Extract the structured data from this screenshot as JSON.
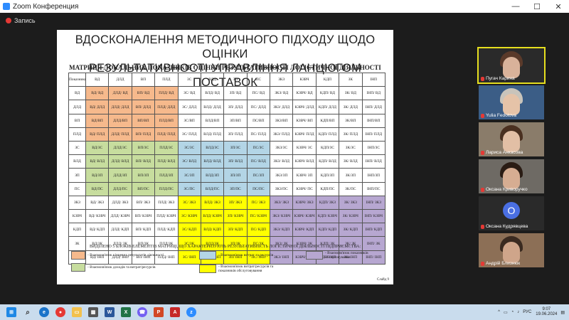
{
  "window": {
    "title": "Zoom Конференция",
    "minimize": "—",
    "maximize": "☐",
    "close": "✕"
  },
  "recording": {
    "label": "Запись"
  },
  "slide": {
    "title_line1": "ВДОСКОНАЛЕННЯ МЕТОДИЧНОГО ПІДХОДУ ЩОДО ОЦІНКИ",
    "title_line2": "РЕЗУЛЬТАТИВНОСТІ УПРАВЛІННЯ ЛАНЦЮГОМ ПОСТАВОК",
    "matrix_title": "МАТРИЦЯ ЛОКАЛЬНИХ ПОКАЗНИКІВ ОЦІНКИ РЕЗУЛЬТАТИВНОСТІ ЛОГІСТИЧНОЇ ДІЯЛЬНОСТІ",
    "header": [
      "Показники",
      "ВД",
      "ДЛД",
      "ВП",
      "ПЛД",
      "ЗС",
      "ВЛД",
      "ЗП",
      "ПС",
      "ЗКЗ",
      "КЗВЧ",
      "КДП",
      "ЗК",
      "ІНП"
    ],
    "rows": [
      [
        [
          "ВД",
          ""
        ],
        [
          "ВД/ ВД",
          "o"
        ],
        [
          "ДЛД/ ВД",
          "o"
        ],
        [
          "ВП/ ВД",
          "o"
        ],
        [
          "ПЛД/ ВД",
          "o"
        ],
        [
          "ЗС/ ВД",
          ""
        ],
        [
          "ВЛД/ ВД",
          ""
        ],
        [
          "ЗП/ ВД",
          ""
        ],
        [
          "ПС/ ВД",
          ""
        ],
        [
          "ЗКЗ/ ВД",
          ""
        ],
        [
          "КЗВЧ/ ВД",
          ""
        ],
        [
          "КДП/ ВД",
          ""
        ],
        [
          "ЗК/ ВД",
          ""
        ],
        [
          "ІНП/ ВД",
          ""
        ]
      ],
      [
        [
          "ДЛД",
          ""
        ],
        [
          "ВД/ ДЛД",
          "o"
        ],
        [
          "ДЛД/ ДЛД",
          "o"
        ],
        [
          "ВП/ ДЛД",
          "o"
        ],
        [
          "ПЛД/ ДЛД",
          "o"
        ],
        [
          "ЗС/ ДЛД",
          ""
        ],
        [
          "ВЛД/ ДЛД",
          ""
        ],
        [
          "ЗП/ ДЛД",
          ""
        ],
        [
          "ПС/ ДЛД",
          ""
        ],
        [
          "ЗКЗ/ ДЛД",
          ""
        ],
        [
          "КЗВЧ/ ДЛД",
          ""
        ],
        [
          "КДП/ ДЛД",
          ""
        ],
        [
          "ЗК/ ДЛД",
          ""
        ],
        [
          "ІНП/ ДЛД",
          ""
        ]
      ],
      [
        [
          "ВП",
          ""
        ],
        [
          "ВД/ВП",
          "o"
        ],
        [
          "ДЛД/ВП",
          "o"
        ],
        [
          "ВП/ВП",
          "o"
        ],
        [
          "ПЛД/ВП",
          "o"
        ],
        [
          "ЗС/ВП",
          ""
        ],
        [
          "ВЛД/ВП",
          ""
        ],
        [
          "ЗП/ВП",
          ""
        ],
        [
          "ПС/ВП",
          ""
        ],
        [
          "ЗКЗ/ВП",
          ""
        ],
        [
          "КЗВЧ/ ВП",
          ""
        ],
        [
          "КДП/ВП",
          ""
        ],
        [
          "ЗК/ВП",
          ""
        ],
        [
          "ІНП/ВП",
          ""
        ]
      ],
      [
        [
          "ПЛД",
          ""
        ],
        [
          "ВД/ ПЛД",
          "o"
        ],
        [
          "ДЛД/ ПЛД",
          "o"
        ],
        [
          "ВП/ ПЛД",
          "o"
        ],
        [
          "ПЛД/ ПЛД",
          "o"
        ],
        [
          "ЗС/ ПЛД",
          ""
        ],
        [
          "ВЛД/ ПЛД",
          ""
        ],
        [
          "ЗП/ ПЛД",
          ""
        ],
        [
          "ПС/ ПЛД",
          ""
        ],
        [
          "ЗКЗ/ ПЛД",
          ""
        ],
        [
          "КЗВЧ/ ПЛД",
          ""
        ],
        [
          "КДП/ ПЛД",
          ""
        ],
        [
          "ЗК/ ПЛД",
          ""
        ],
        [
          "ІНП/ ПЛД",
          ""
        ]
      ],
      [
        [
          "ЗС",
          ""
        ],
        [
          "ВД/ЗС",
          "g"
        ],
        [
          "ДЛД/ЗС",
          "g"
        ],
        [
          "ВП/ЗС",
          "g"
        ],
        [
          "ПЛД/ЗС",
          "g"
        ],
        [
          "ЗС/ЗС",
          "b"
        ],
        [
          "ВЛД/ЗС",
          "b"
        ],
        [
          "ЗП/ЗС",
          "b"
        ],
        [
          "ПС/ЗС",
          "b"
        ],
        [
          "ЗКЗ/ЗС",
          ""
        ],
        [
          "КЗВЧ/ ЗС",
          ""
        ],
        [
          "КДП/ЗС",
          ""
        ],
        [
          "ЗК/ЗС",
          ""
        ],
        [
          "ІНП/ЗС",
          ""
        ]
      ],
      [
        [
          "ВЛД",
          ""
        ],
        [
          "ВД/ ВЛД",
          "g"
        ],
        [
          "ДЛД/ ВЛД",
          "g"
        ],
        [
          "ВП/ ВЛД",
          "g"
        ],
        [
          "ПЛД/ ВЛД",
          "g"
        ],
        [
          "ЗС/ ВЛД",
          "b"
        ],
        [
          "ВЛД/ ВЛД",
          "b"
        ],
        [
          "ЗП/ ВЛД",
          "b"
        ],
        [
          "ПС/ ВЛД",
          "b"
        ],
        [
          "ЗКЗ/ ВЛД",
          ""
        ],
        [
          "КЗВЧ/ ВЛД",
          ""
        ],
        [
          "КДП/ ВЛД",
          ""
        ],
        [
          "ЗК/ ВЛД",
          ""
        ],
        [
          "ІНП/ ВЛД",
          ""
        ]
      ],
      [
        [
          "ЗП",
          ""
        ],
        [
          "ВД/ЗП",
          "g"
        ],
        [
          "ДЛД/ЗП",
          "g"
        ],
        [
          "ВП/ЗП",
          "g"
        ],
        [
          "ПЛД/ЗП",
          "g"
        ],
        [
          "ЗС/ЗП",
          "b"
        ],
        [
          "ВЛД/ЗП",
          "b"
        ],
        [
          "ЗП/ЗП",
          "b"
        ],
        [
          "ПС/ЗП",
          "b"
        ],
        [
          "ЗКЗ/ЗП",
          ""
        ],
        [
          "КЗВЧ/ ЗП",
          ""
        ],
        [
          "КДП/ЗП",
          ""
        ],
        [
          "ЗК/ЗП",
          ""
        ],
        [
          "ІНП/ЗП",
          ""
        ]
      ],
      [
        [
          "ПС",
          ""
        ],
        [
          "ВД/ПС",
          "g"
        ],
        [
          "ДЛД/ПС",
          "g"
        ],
        [
          "ВП/ПС",
          "g"
        ],
        [
          "ПЛД/ПС",
          "g"
        ],
        [
          "ЗС/ПС",
          "b"
        ],
        [
          "ВЛД/ПС",
          "b"
        ],
        [
          "ЗП/ПС",
          "b"
        ],
        [
          "ПС/ПС",
          "b"
        ],
        [
          "ЗКЗ/ПС",
          ""
        ],
        [
          "КЗВЧ/ ПС",
          ""
        ],
        [
          "КДП/ПС",
          ""
        ],
        [
          "ЗК/ПС",
          ""
        ],
        [
          "ІНП/ПС",
          ""
        ]
      ],
      [
        [
          "ЗКЗ",
          ""
        ],
        [
          "ВД/ ЗКЗ",
          ""
        ],
        [
          "ДЛД/ ЗКЗ",
          ""
        ],
        [
          "ВП/ ЗКЗ",
          ""
        ],
        [
          "ПЛД/ ЗКЗ",
          ""
        ],
        [
          "ЗС/ ЗКЗ",
          "y"
        ],
        [
          "ВЛД/ ЗКЗ",
          "y"
        ],
        [
          "ЗП/ ЗКЗ",
          "y"
        ],
        [
          "ПС/ ЗКЗ",
          "y"
        ],
        [
          "ЗКЗ/ ЗКЗ",
          "p"
        ],
        [
          "КЗВЧ/ ЗКЗ",
          "p"
        ],
        [
          "КДП/ ЗКЗ",
          "p"
        ],
        [
          "ЗК/ ЗКЗ",
          "p"
        ],
        [
          "ІНП/ ЗКЗ",
          "p"
        ]
      ],
      [
        [
          "КЗВЧ",
          ""
        ],
        [
          "ВД/ КЗВЧ",
          ""
        ],
        [
          "ДЛД/ КЗВЧ",
          ""
        ],
        [
          "ВП/ КЗВЧ",
          ""
        ],
        [
          "ПЛД/ КЗВЧ",
          ""
        ],
        [
          "ЗС/ КЗВЧ",
          "y"
        ],
        [
          "ВЛД/ КЗВЧ",
          "y"
        ],
        [
          "ЗП/ КЗВЧ",
          "y"
        ],
        [
          "ПС/ КЗВЧ",
          "y"
        ],
        [
          "ЗКЗ/ КЗВЧ",
          "p"
        ],
        [
          "КЗВЧ/ КЗВЧ",
          "p"
        ],
        [
          "КДП/ КЗВЧ",
          "p"
        ],
        [
          "ЗК/ КЗВЧ",
          "p"
        ],
        [
          "ІНП/ КЗВЧ",
          "p"
        ]
      ],
      [
        [
          "КДП",
          ""
        ],
        [
          "ВД/ КДП",
          ""
        ],
        [
          "ДЛД/ КДП",
          ""
        ],
        [
          "ВП/ КДП",
          ""
        ],
        [
          "ПЛД/ КДП",
          ""
        ],
        [
          "ЗС/ КДП",
          "y"
        ],
        [
          "ВЛД/ КДП",
          "y"
        ],
        [
          "ЗП/ КДП",
          "y"
        ],
        [
          "ПС/ КДП",
          "y"
        ],
        [
          "ЗКЗ/ КДП",
          "p"
        ],
        [
          "КЗВЧ/ КДП",
          "p"
        ],
        [
          "КДП/ КДП",
          "p"
        ],
        [
          "ЗК/ КДП",
          "p"
        ],
        [
          "ІНП/ КДП",
          "p"
        ]
      ],
      [
        [
          "ЗК",
          ""
        ],
        [
          "ВД/ЗК",
          ""
        ],
        [
          "ДЛД/ ЗК",
          ""
        ],
        [
          "ВП/ЗК",
          ""
        ],
        [
          "ПЛД/ЗК",
          ""
        ],
        [
          "ЗС/ЗК",
          "y"
        ],
        [
          "ВЛД/ЗК",
          "y"
        ],
        [
          "ЗП/ЗК",
          "y"
        ],
        [
          "ПС/ЗК",
          "y"
        ],
        [
          "ЗКЗ/ ЗК",
          "p"
        ],
        [
          "КЗВЧ/ ЗК",
          "p"
        ],
        [
          "КДП/ ЗК",
          "p"
        ],
        [
          "ЗК/ ЗК",
          "p"
        ],
        [
          "ІНП/ ЗК",
          "p"
        ]
      ],
      [
        [
          "ІНП",
          ""
        ],
        [
          "ВД/ ІНП",
          ""
        ],
        [
          "ДЛД/ ІНП",
          ""
        ],
        [
          "ВП/ ІНП",
          ""
        ],
        [
          "ПЛД/ ІНП",
          ""
        ],
        [
          "ЗС/ ІНП",
          "y"
        ],
        [
          "ВЛД/ ІНП",
          "y"
        ],
        [
          "ЗП/ ІНП",
          "y"
        ],
        [
          "ПС/ ІНП",
          "y"
        ],
        [
          "ЗКЗ/ ІНП",
          "p"
        ],
        [
          "КЗВЧ/ ІНП",
          "p"
        ],
        [
          "КДП/ ІНП",
          "p"
        ],
        [
          "ЗК/ ІНП",
          "p"
        ],
        [
          "ІНП/ ІНП",
          "p"
        ]
      ]
    ],
    "legend_title": "ВИДІЛЕНО 5 БЛОКІВ ЕЛЕМЕНТІВ МАТРИЦІ, ЩО ХАРАКТЕРИЗУЮТЬ РЕЗУЛЬТАТИВНІСТЬ ЛОГІСТИЧНОЇ ДІЯЛЬНОСТІ ПІДПРИЄМСТВА:",
    "legend": {
      "orange": "- Взаємозв'язок кінцевих результатів діяльності",
      "green": "- Взаємозв'язок доходів та витрат/ресурсів",
      "blue": "- Взаємозв'язок витрат та ресурсів",
      "yellow": "- Взаємозв'язок витрат/ресурсів та показників обслуговування",
      "purple": "- Взаємозв'язок показників обслуговування"
    },
    "slide_number": "Слайд 9"
  },
  "participants": [
    {
      "name": "Пугач Карина"
    },
    {
      "name": "Yulia Fedotova"
    },
    {
      "name": "Лариса Анкасова"
    },
    {
      "name": "Оксана Криворучко"
    },
    {
      "name": "Оксана Кудрявцева",
      "initial": "O"
    },
    {
      "name": "Андрій Близнюк"
    }
  ],
  "taskbar": {
    "lang": "РУС",
    "time": "9:07",
    "date": "19.06.2024",
    "icons": [
      "windows-start",
      "search",
      "edge",
      "chrome",
      "file-explorer",
      "store",
      "word",
      "excel",
      "viber",
      "powerpoint",
      "acrobat",
      "zoom"
    ]
  },
  "colors": {
    "o": "#f6b98c",
    "g": "#c7dd9e",
    "b": "#b3d5e6",
    "y": "#ffff00",
    "p": "#b7a7d1",
    "zoom_blue": "#2d8cff",
    "active_speaker": "#e6df1f"
  }
}
